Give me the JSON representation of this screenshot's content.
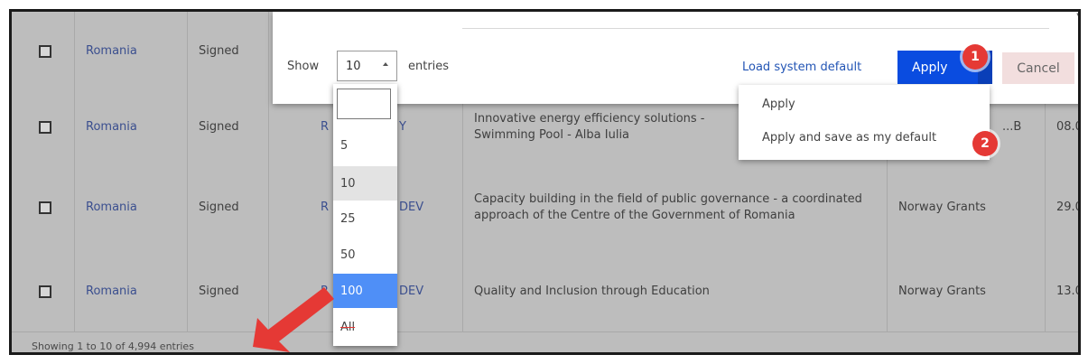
{
  "toolbar": {
    "show_label": "Show",
    "entries_label": "entries",
    "page_size_value": "10",
    "load_default_label": "Load system default",
    "apply_label": "Apply",
    "cancel_label": "Cancel"
  },
  "apply_menu": {
    "items": [
      "Apply",
      "Apply and save as my default"
    ]
  },
  "page_size_dropdown": {
    "filter_value": "",
    "options": [
      "5",
      "10",
      "25",
      "50",
      "100",
      "All"
    ],
    "selected": "10",
    "hovered": "100"
  },
  "table": {
    "rows": [
      {
        "country": "Romania",
        "status": "Signed",
        "ref": "",
        "title": "",
        "donor": "",
        "date": ""
      },
      {
        "country": "Romania",
        "status": "Signed",
        "ref": "R",
        "ref_tail": "Y",
        "title": "Innovative energy efficiency solutions - Swimming Pool - Alba Iulia",
        "donor": "...B",
        "date": "08.0"
      },
      {
        "country": "Romania",
        "status": "Signed",
        "ref": "R",
        "ref_tail": "DEV",
        "title": "Capacity building in the field of public governance - a coordinated approach of the Centre of the Government of Romania",
        "donor": "Norway Grants",
        "date": "29.0"
      },
      {
        "country": "Romania",
        "status": "Signed",
        "ref": "R",
        "ref_tail": "DEV",
        "title": "Quality and Inclusion through Education",
        "donor": "Norway Grants",
        "date": "13.0"
      }
    ],
    "footer": "Showing 1 to 10 of 4,994 entries"
  },
  "annotations": {
    "badge_1": "1",
    "badge_2": "2",
    "arrow_color": "#e53935"
  }
}
